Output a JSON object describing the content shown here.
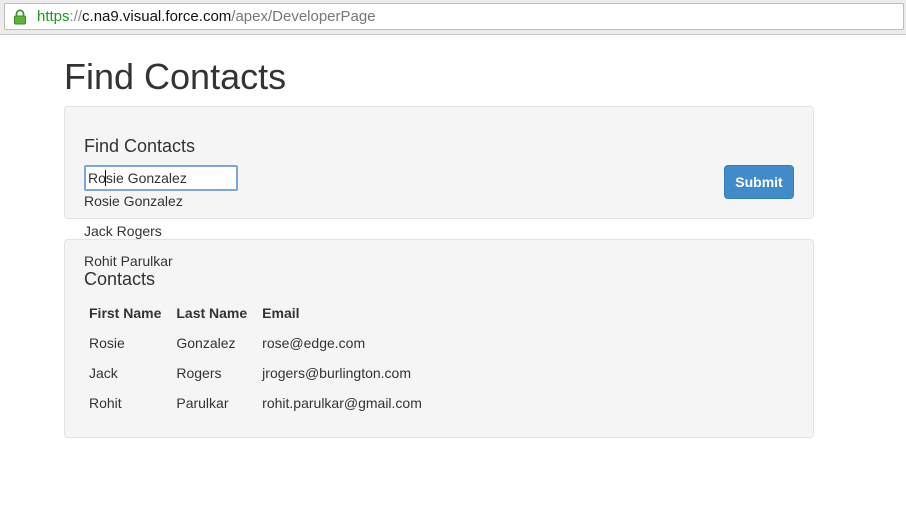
{
  "browser": {
    "url_scheme": "https",
    "url_separator": "://",
    "url_host": "c.na9.visual.force.com",
    "url_path": "/apex/DeveloperPage"
  },
  "page": {
    "title": "Find Contacts"
  },
  "find_panel": {
    "heading": "Find Contacts",
    "search_value": "Rosie Gonzalez",
    "submit_label": "Submit",
    "suggestions": [
      "Rosie Gonzalez",
      "Jack Rogers",
      "Rohit Parulkar"
    ]
  },
  "contacts_panel": {
    "heading": "Contacts",
    "columns": [
      "First Name",
      "Last Name",
      "Email"
    ],
    "rows": [
      {
        "first": "Rosie",
        "last": "Gonzalez",
        "email": "rose@edge.com"
      },
      {
        "first": "Jack",
        "last": "Rogers",
        "email": "jrogers@burlington.com"
      },
      {
        "first": "Rohit",
        "last": "Parulkar",
        "email": "rohit.parulkar@gmail.com"
      }
    ]
  },
  "colors": {
    "accent": "#428bca",
    "secure_green": "#1b9a1b",
    "panel_bg": "#f5f5f5"
  },
  "icons": {
    "lock": "lock-icon"
  }
}
